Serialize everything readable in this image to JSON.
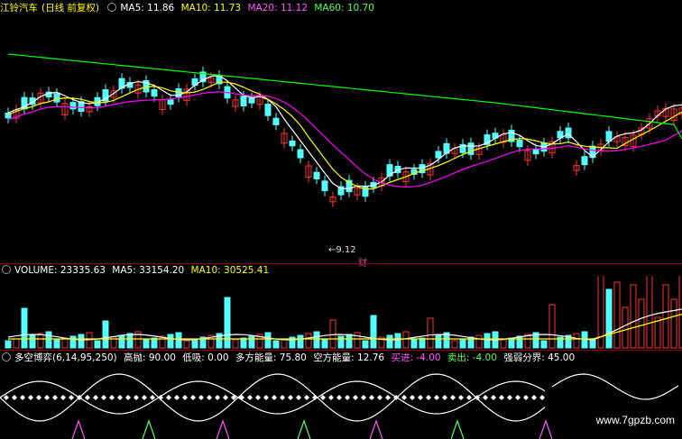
{
  "main": {
    "stock_name": "江铃汽车",
    "period": "(日线 前复权)",
    "ma5": "MA5: 11.86",
    "ma10": "MA10: 11.73",
    "ma20": "MA20: 11.12",
    "ma60": "MA60: 10.70",
    "low_marker": "←9.12",
    "finance_marker": "财"
  },
  "volume": {
    "title": "VOLUME: 23335.63",
    "ma5": "MA5: 33154.20",
    "ma10": "MA10: 30525.41"
  },
  "indicator": {
    "name": "多空博弈(6,14,95,250)",
    "high": "高抛: 90.00",
    "low": "低吸: 0.00",
    "bull": "多方能量: 75.80",
    "bear": "空方能量: 12.76",
    "buy": "买进: -4.00",
    "sell": "卖出: -4.00",
    "boundary": "强弱分界: 45.00"
  },
  "watermark": "www.7gpzb.com",
  "colors": {
    "up": "#ff3232",
    "down": "#54ffff",
    "ma5": "#ffffff",
    "ma10": "#ffff00",
    "ma20": "#ff00ff",
    "ma60": "#00ff00"
  }
}
